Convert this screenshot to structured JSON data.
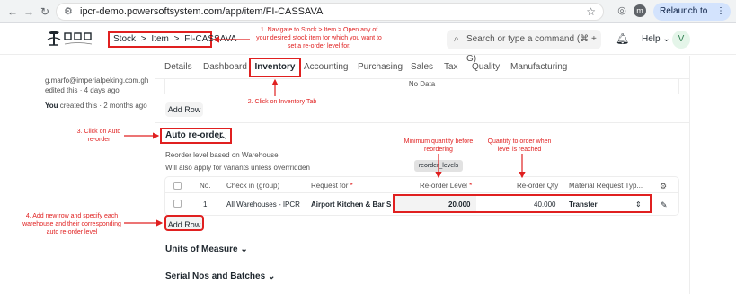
{
  "browser": {
    "back": "←",
    "forward": "→",
    "reload": "↻",
    "url": "ipcr-demo.powersoftsystem.com/app/item/FI-CASSAVA",
    "profile_initial": "m",
    "relaunch_label": "Relaunch to update",
    "relaunch_menu": "⋮"
  },
  "header": {
    "breadcrumb": [
      "Stock",
      "Item",
      "FI-CASSAVA"
    ],
    "breadcrumb_sep": ">",
    "search_placeholder": "Search or type a command (⌘ + G)",
    "help_label": "Help",
    "user_initial": "V"
  },
  "sidebar": {
    "email": "g.marfo@imperialpeking.com.gh",
    "edited": "edited this · 4 days ago",
    "you": "You",
    "created": "created this · 2 months ago"
  },
  "tabs": [
    "Details",
    "Dashboard",
    "Inventory",
    "Accounting",
    "Purchasing",
    "Sales",
    "Tax",
    "Quality",
    "Manufacturing"
  ],
  "active_tab": "Inventory",
  "top_section": {
    "no_data": "No Data",
    "add_row": "Add Row"
  },
  "auto_reorder": {
    "title": "Auto re-order",
    "desc1": "Reorder level based on Warehouse",
    "desc2": "Will also apply for variants unless overrridden",
    "tooltip": "reorder_levels",
    "columns": {
      "no": "No.",
      "check_in_group": "Check in (group)",
      "request_for": "Request for",
      "reorder_level": "Re-order Level",
      "reorder_qty": "Re-order Qty",
      "material_request_type": "Material Request Typ..."
    },
    "required_mark": "*",
    "rows": [
      {
        "no": "1",
        "check_in_group": "All Warehouses - IPCR",
        "request_for": "Airport Kitchen & Bar S",
        "reorder_level": "20.000",
        "reorder_qty": "40.000",
        "material_request_type": "Transfer"
      }
    ],
    "add_row": "Add Row"
  },
  "collapsed_sections": [
    "Units of Measure",
    "Serial Nos and Batches"
  ],
  "annotations": {
    "step1": "1. Navigate to  Stock > Item > Open any of your desired stock item for which you want to set a re-order level for.",
    "step2": "2. Click on Inventory Tab",
    "step3": "3. Click on Auto re-order",
    "step4": "4. Add new row and specify each warehouse and their corresponding auto re-order level",
    "min_qty": "Minimum quantity before reordering",
    "order_qty": "Quantity to order when level is reached"
  },
  "colors": {
    "annotation_red": "#e02020",
    "relaunch_bg": "#d3e3fd"
  }
}
